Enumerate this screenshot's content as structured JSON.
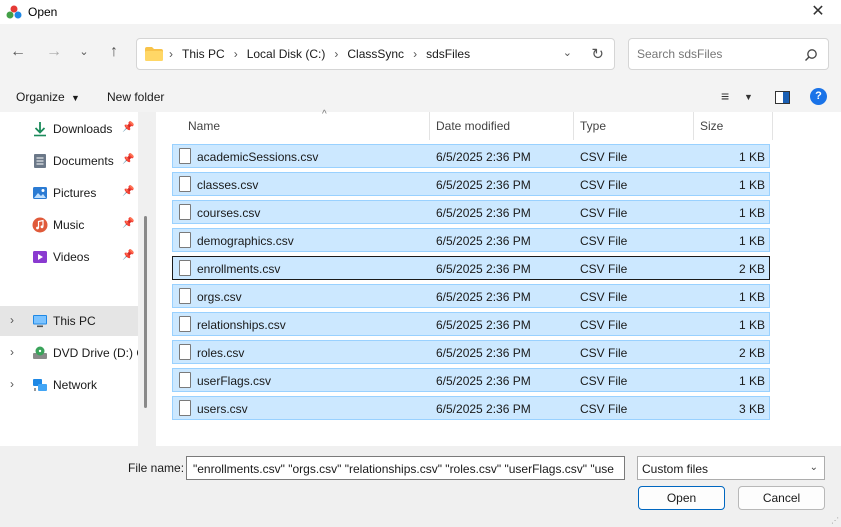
{
  "window": {
    "title": "Open",
    "close_icon": "close-icon"
  },
  "address": {
    "crumbs": [
      "This PC",
      "Local Disk (C:)",
      "ClassSync",
      "sdsFiles"
    ],
    "search_placeholder": "Search sdsFiles"
  },
  "toolbar": {
    "organize": "Organize",
    "new_folder": "New folder"
  },
  "nav": {
    "items": [
      {
        "label": "Downloads",
        "icon": "download-icon",
        "color": "#1b8a5a"
      },
      {
        "label": "Documents",
        "icon": "document-icon",
        "color": "#5f6b7a"
      },
      {
        "label": "Pictures",
        "icon": "pictures-icon",
        "color": "#2b7bd3"
      },
      {
        "label": "Music",
        "icon": "music-icon",
        "color": "#e05a3a"
      },
      {
        "label": "Videos",
        "icon": "video-icon",
        "color": "#8a3ad0"
      }
    ],
    "tree": [
      {
        "label": "This PC",
        "icon": "computer-icon"
      },
      {
        "label": "DVD Drive (D:) C",
        "icon": "dvd-drive-icon"
      },
      {
        "label": "Network",
        "icon": "network-icon"
      }
    ]
  },
  "columns": {
    "name": "Name",
    "date": "Date modified",
    "type": "Type",
    "size": "Size"
  },
  "files": [
    {
      "name": "academicSessions.csv",
      "date": "6/5/2025 2:36 PM",
      "type": "CSV File",
      "size": "1 KB"
    },
    {
      "name": "classes.csv",
      "date": "6/5/2025 2:36 PM",
      "type": "CSV File",
      "size": "1 KB"
    },
    {
      "name": "courses.csv",
      "date": "6/5/2025 2:36 PM",
      "type": "CSV File",
      "size": "1 KB"
    },
    {
      "name": "demographics.csv",
      "date": "6/5/2025 2:36 PM",
      "type": "CSV File",
      "size": "1 KB"
    },
    {
      "name": "enrollments.csv",
      "date": "6/5/2025 2:36 PM",
      "type": "CSV File",
      "size": "2 KB"
    },
    {
      "name": "orgs.csv",
      "date": "6/5/2025 2:36 PM",
      "type": "CSV File",
      "size": "1 KB"
    },
    {
      "name": "relationships.csv",
      "date": "6/5/2025 2:36 PM",
      "type": "CSV File",
      "size": "1 KB"
    },
    {
      "name": "roles.csv",
      "date": "6/5/2025 2:36 PM",
      "type": "CSV File",
      "size": "2 KB"
    },
    {
      "name": "userFlags.csv",
      "date": "6/5/2025 2:36 PM",
      "type": "CSV File",
      "size": "1 KB"
    },
    {
      "name": "users.csv",
      "date": "6/5/2025 2:36 PM",
      "type": "CSV File",
      "size": "3 KB"
    }
  ],
  "bottom": {
    "file_name_label": "File name:",
    "file_name_value": "\"enrollments.csv\" \"orgs.csv\" \"relationships.csv\" \"roles.csv\" \"userFlags.csv\" \"use",
    "file_type": "Custom files",
    "open": "Open",
    "cancel": "Cancel"
  },
  "colors": {
    "selection": "#cce8ff",
    "selection_border": "#99d1ff",
    "accent": "#0067c0"
  }
}
